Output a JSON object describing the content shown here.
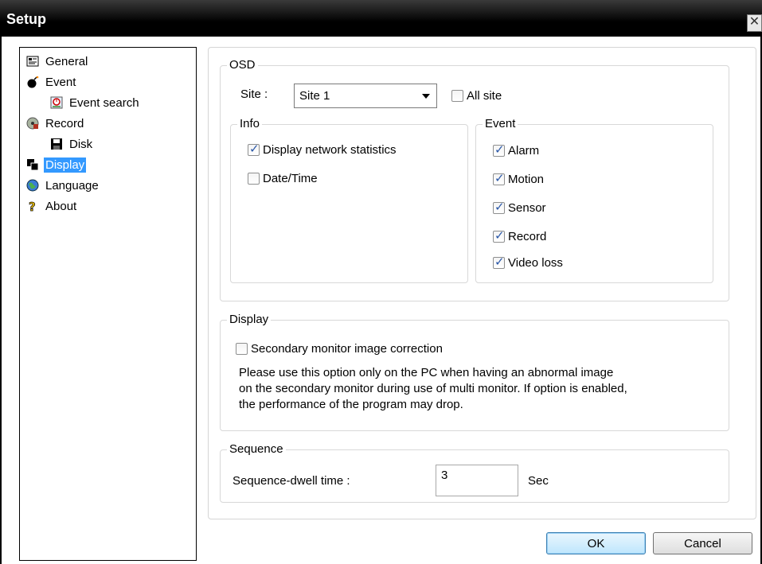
{
  "window": {
    "title": "Setup",
    "close_glyph": "✕"
  },
  "tree": {
    "items": [
      {
        "label": "General",
        "icon": "general-icon"
      },
      {
        "label": "Event",
        "icon": "event-bomb-icon"
      },
      {
        "label": "Event search",
        "icon": "event-search-icon"
      },
      {
        "label": "Record",
        "icon": "record-icon"
      },
      {
        "label": "Disk",
        "icon": "disk-icon"
      },
      {
        "label": "Display",
        "icon": "display-icon",
        "selected": true
      },
      {
        "label": "Language",
        "icon": "globe-icon"
      },
      {
        "label": "About",
        "icon": "question-icon"
      }
    ]
  },
  "osd": {
    "legend": "OSD",
    "site_label": "Site :",
    "site_value": "Site 1",
    "all_site_label": "All site",
    "all_site_checked": false,
    "info": {
      "legend": "Info",
      "display_network_statistics": {
        "label": "Display network statistics",
        "checked": true
      },
      "date_time": {
        "label": "Date/Time",
        "checked": false
      }
    },
    "event": {
      "legend": "Event",
      "alarm": {
        "label": "Alarm",
        "checked": true
      },
      "motion": {
        "label": "Motion",
        "checked": true
      },
      "sensor": {
        "label": "Sensor",
        "checked": true
      },
      "record": {
        "label": "Record",
        "checked": true
      },
      "video_loss": {
        "label": "Video loss",
        "checked": true
      }
    }
  },
  "display_group": {
    "legend": "Display",
    "secondary_monitor": {
      "label": "Secondary monitor image correction",
      "checked": false
    },
    "description": [
      "Please use this option only on the PC when having an abnormal image",
      "on the secondary monitor during use of multi monitor. If option is enabled,",
      "the performance of the program may drop."
    ]
  },
  "sequence": {
    "legend": "Sequence",
    "dwell_label": "Sequence-dwell time :",
    "dwell_value": "3",
    "unit": "Sec"
  },
  "buttons": {
    "ok": "OK",
    "cancel": "Cancel"
  },
  "colors": {
    "selection": "#3399ff",
    "titlebar": "#000000",
    "checkmark": "#2b58a8"
  }
}
